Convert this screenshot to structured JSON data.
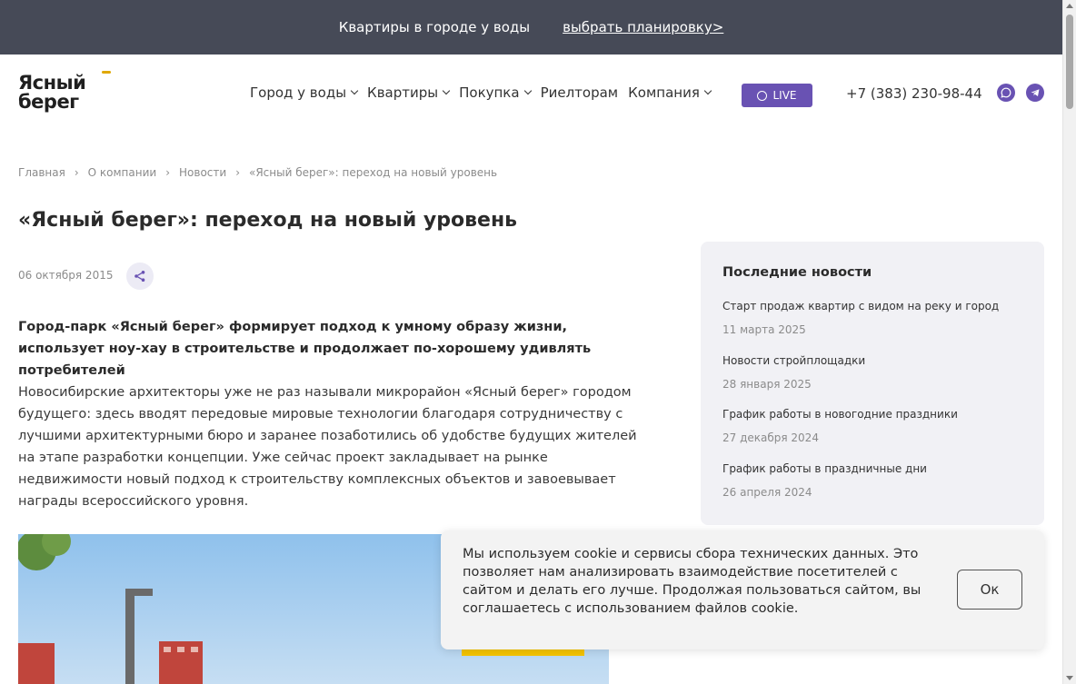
{
  "promo_bar": {
    "text": "Квартиры в городе у воды",
    "link": "выбрать планировку>"
  },
  "header": {
    "logo_line1": "Ясный",
    "logo_line2": "берег",
    "nav": [
      {
        "label": "Город у воды",
        "has_dropdown": true
      },
      {
        "label": "Квартиры",
        "has_dropdown": true
      },
      {
        "label": "Покупка",
        "has_dropdown": true
      },
      {
        "label": "Риелторам",
        "has_dropdown": false
      },
      {
        "label": "Компания",
        "has_dropdown": true
      }
    ],
    "live_label": "LIVE",
    "phone": "+7 (383) 230-98-44",
    "social_icons": [
      "whatsapp-icon",
      "telegram-icon"
    ],
    "accent_color": "#6952b3"
  },
  "breadcrumb": [
    "Главная",
    "О компании",
    "Новости",
    "«Ясный берег»: переход на новый уровень"
  ],
  "article": {
    "title": "«Ясный берег»: переход на новый уровень",
    "date": "06 октября 2015",
    "lead": "Город-парк «Ясный берег» формирует подход к умному образу жизни, использует ноу-хау в строительстве и продолжает по-хорошему удивлять потребителей",
    "body": "Новосибирские архитекторы уже не раз называли микрорайон «Ясный берег» городом будущего: здесь вводят передовые мировые технологии благодаря сотрудничеству с лучшими архитектурными бюро и заранее позаботились об удобстве будущих жителей на этапе разработки концепции. Уже сейчас проект закладывает на рынке недвижимости новый подход к строительству комплексных объектов и завоевывает награды всероссийского уровня."
  },
  "sidebar": {
    "heading": "Последние новости",
    "items": [
      {
        "title": "Старт продаж квартир с видом на реку и город",
        "date": "11 марта 2025"
      },
      {
        "title": "Новости стройплощадки",
        "date": "28 января 2025"
      },
      {
        "title": "График работы в новогодние праздники",
        "date": "27 декабря 2024"
      },
      {
        "title": "График работы в праздничные дни",
        "date": "26 апреля 2024"
      }
    ]
  },
  "cookie": {
    "message": "Мы используем cookie и сервисы сбора технических данных. Это позволяет нам анализировать взаимодействие посетителей с сайтом и делать его лучше. Продолжая пользоваться сайтом, вы соглашаетесь с использованием файлов cookie.",
    "ok_label": "Ок"
  }
}
